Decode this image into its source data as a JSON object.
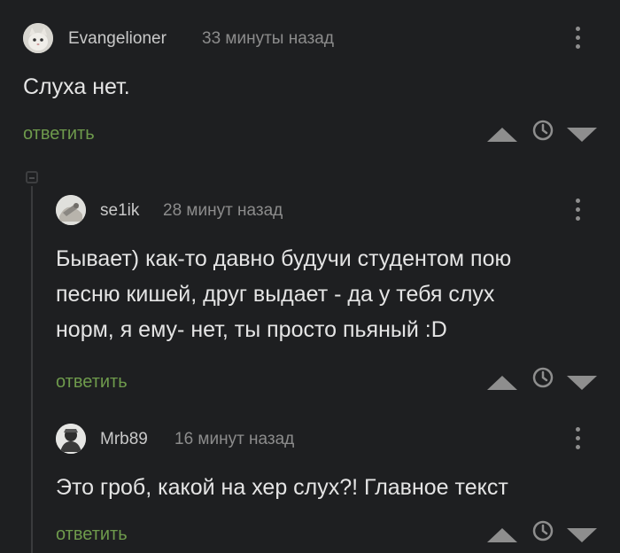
{
  "comments": [
    {
      "author": "Evangelioner",
      "time": "33 минуты назад",
      "text_lines": [
        "Слуха нет."
      ],
      "reply_label": "ответить"
    },
    {
      "author": "se1ik",
      "time": "28 минут назад",
      "text_lines": [
        "Бывает) как-то давно будучи студентом пою",
        "песню кишей, друг выдает - да у тебя слух",
        "норм, я ему- нет, ты просто пьяный :D"
      ],
      "reply_label": "ответить"
    },
    {
      "author": "Mrb89",
      "time": "16 минут назад",
      "text_lines": [
        "Это гроб, какой на хер слух?! Главное текст"
      ],
      "reply_label": "ответить"
    }
  ],
  "icons": {
    "upvote": "triangle-up-icon",
    "downvote": "triangle-down-icon",
    "clock": "clock-icon",
    "more": "vertical-dots-icon"
  },
  "colors": {
    "background": "#1e1f21",
    "reply_link": "#6e9a4c",
    "author": "#c9c9c9",
    "time": "#8c8c8c",
    "text": "#e4e4e4",
    "icon": "#8e8e8e"
  }
}
